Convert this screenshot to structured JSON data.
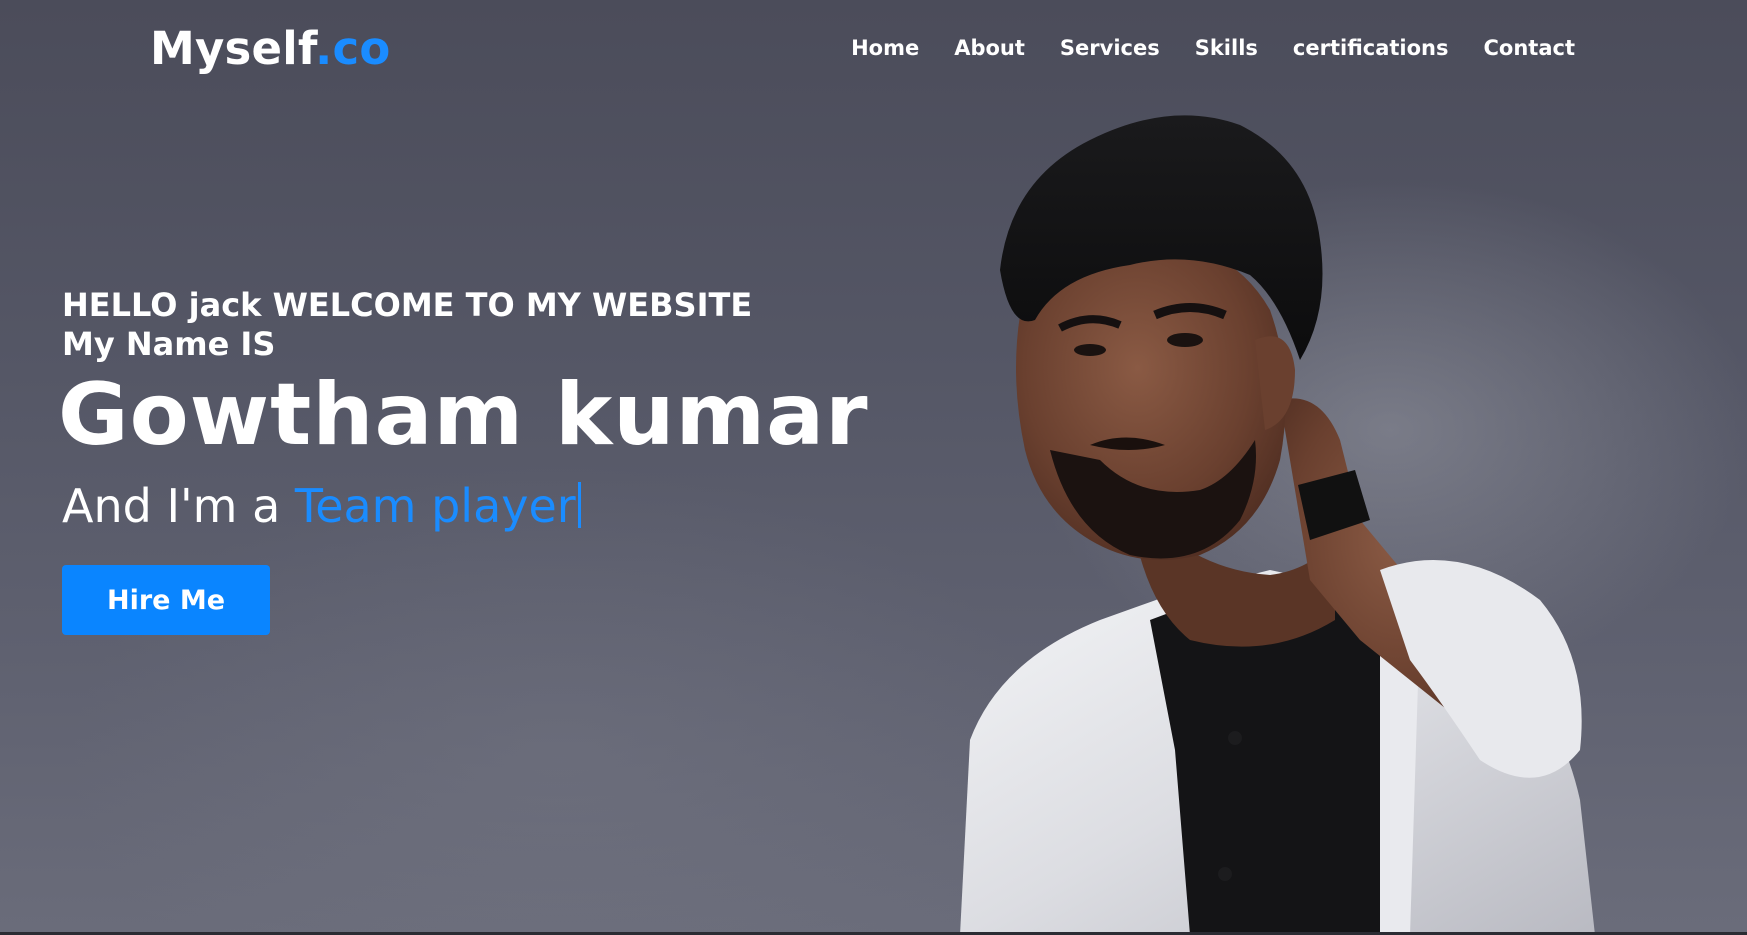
{
  "brand": {
    "name_main": "Myself",
    "name_accent": ".co",
    "accent_color": "#1a8cff"
  },
  "nav": {
    "items": [
      "Home",
      "About",
      "Services",
      "Skills",
      "certifications",
      "Contact"
    ]
  },
  "hero": {
    "greeting_line1": "HELLO jack WELCOME TO MY WEBSITE",
    "greeting_line2": "My Name IS",
    "name": "Gowtham kumar",
    "tagline_prefix": "And I'm a ",
    "tagline_role": "Team player",
    "cta_label": "Hire Me",
    "cta_color": "#0a85ff",
    "photo_icon": "person-portrait-photo"
  }
}
